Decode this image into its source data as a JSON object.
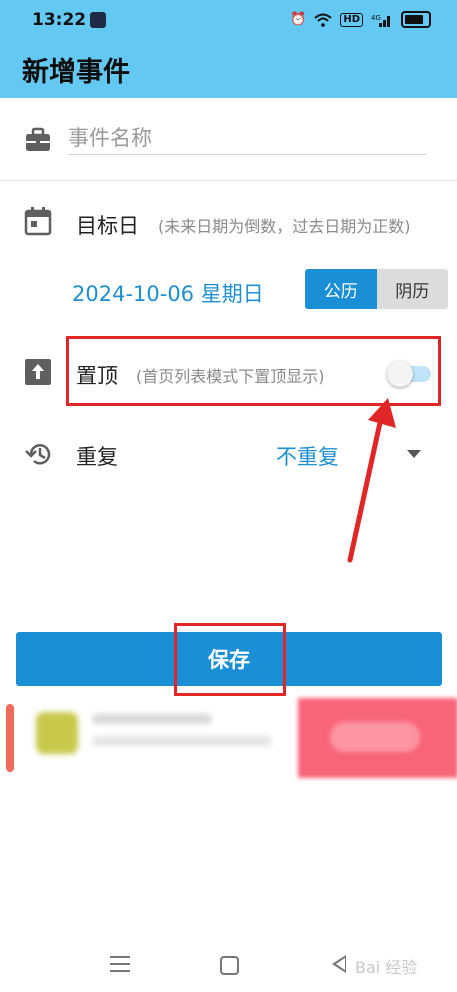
{
  "status_bar": {
    "time": "13:22",
    "hd_label": "HD",
    "network_label": "4G"
  },
  "app_bar": {
    "title": "新增事件"
  },
  "event_name": {
    "placeholder": "事件名称",
    "value": ""
  },
  "target_date": {
    "label": "目标日",
    "hint": "(未来日期为倒数，过去日期为正数)",
    "date": "2024-10-06 星期日",
    "calendar_options": [
      "公历",
      "阴历"
    ],
    "selected_calendar": "公历"
  },
  "pin_top": {
    "label": "置顶",
    "hint": "(首页列表模式下置顶显示)",
    "enabled": false
  },
  "repeat": {
    "label": "重复",
    "value": "不重复"
  },
  "save_button": {
    "label": "保存"
  },
  "colors": {
    "accent": "#1a8fd5",
    "app_bar": "#63c8f2",
    "annotation": "#e02626"
  }
}
